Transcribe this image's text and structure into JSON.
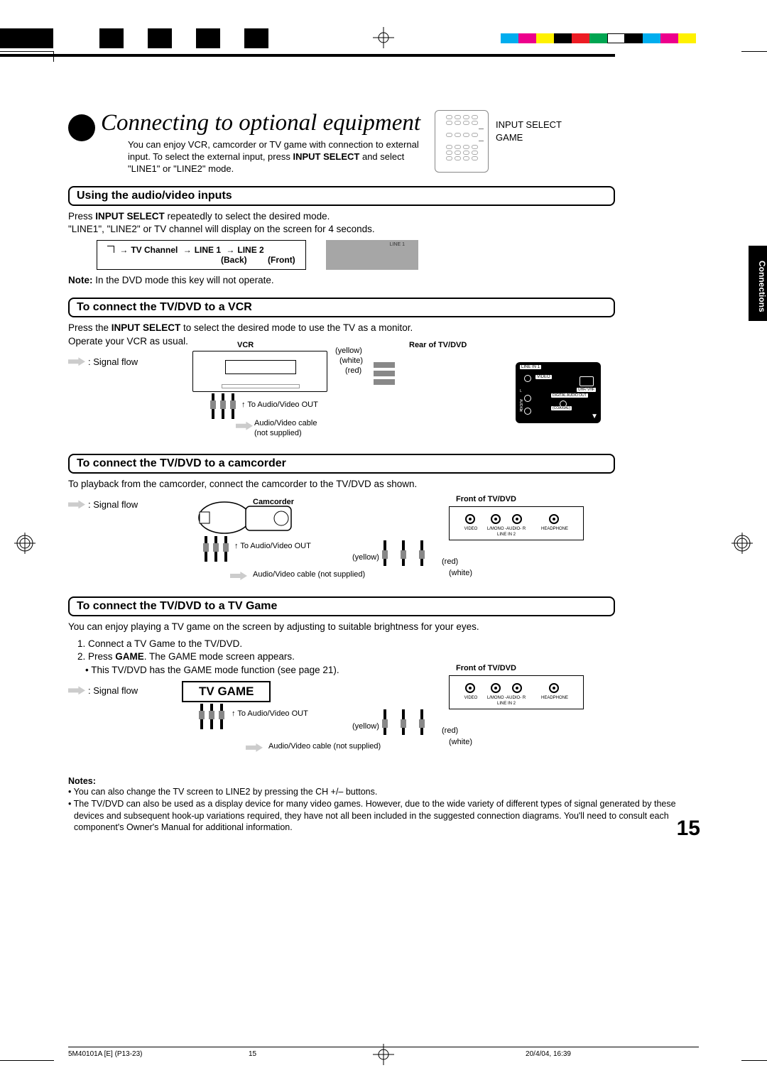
{
  "colorbar": {
    "colors": [
      "#00adee",
      "#ed008c",
      "#fff100",
      "#000",
      "#ec1c24",
      "#00a551",
      "#fff",
      "#000",
      "#00adee",
      "#ed008c",
      "#fff100"
    ]
  },
  "sidetab": "Connections",
  "title": "Connecting to optional equipment",
  "intro": "You can enjoy VCR, camcorder or TV game with connection to external input. To select the external input, press INPUT SELECT and select \"LINE1\" or \"LINE2\" mode.",
  "intro_bold": "INPUT SELECT",
  "remote_labels": {
    "l1": "INPUT SELECT",
    "l2": "GAME"
  },
  "s1": {
    "h": "Using the audio/video inputs",
    "p1a": "Press ",
    "p1b": "INPUT SELECT",
    "p1c": " repeatedly to select the desired mode.",
    "p2": "\"LINE1\", \"LINE2\" or TV channel will display on the screen for 4 seconds.",
    "flow": {
      "a": "TV Channel",
      "b": "LINE 1",
      "bsub": "(Back)",
      "c": "LINE 2",
      "csub": "(Front)"
    },
    "screen": "LINE 1",
    "note_b": "Note:",
    "note": " In the DVD mode this key will not operate."
  },
  "s2": {
    "h": "To connect the TV/DVD to a VCR",
    "p1a": "Press the ",
    "p1b": "INPUT SELECT",
    "p1c": " to select the desired mode to use the TV as a monitor.",
    "p2": "Operate your VCR as usual.",
    "sig": ": Signal flow",
    "vcr": "VCR",
    "rear": "Rear of TV/DVD",
    "yellow": "(yellow)",
    "white": "(white)",
    "red": "(red)",
    "toav": "To Audio/Video OUT",
    "cable": "Audio/Video cable",
    "ns": "(not supplied)",
    "linein": "LINE IN 1",
    "video": "VIDEO",
    "uhf": "UHF/ VHF",
    "dao": "DIGITAL AUDIO OUT",
    "coax": "(COAXIAL)",
    "audio": "AUDIO",
    "L": "L",
    "R": "R"
  },
  "s3": {
    "h": "To connect the TV/DVD to a camcorder",
    "p": "To playback from the camcorder, connect the camcorder to the TV/DVD as shown.",
    "sig": ": Signal flow",
    "cam": "Camcorder",
    "front": "Front of TV/DVD",
    "toav": "To Audio/Video OUT",
    "cable": "Audio/Video cable (not supplied)",
    "yellow": "(yellow)",
    "white": "(white)",
    "red": "(red)",
    "jv": "VIDEO",
    "jl": "L/MONO -AUDIO- R",
    "jh": "HEADPHONE",
    "lin": "LINE IN 2"
  },
  "s4": {
    "h": "To connect the TV/DVD to a TV Game",
    "p": "You can enjoy playing a TV game on the screen by adjusting to suitable brightness for your eyes.",
    "li1": "Connect a TV Game to the TV/DVD.",
    "li2a": "Press ",
    "li2b": "GAME",
    "li2c": ". The GAME mode screen appears.",
    "li2bul": "This TV/DVD has the GAME mode function (see page 21).",
    "sig": ": Signal flow",
    "tvgame": "TV GAME",
    "front": "Front of TV/DVD",
    "toav": "To Audio/Video OUT",
    "cable": "Audio/Video cable (not supplied)",
    "yellow": "(yellow)",
    "white": "(white)",
    "red": "(red)",
    "jv": "VIDEO",
    "jl": "L/MONO -AUDIO- R",
    "jh": "HEADPHONE",
    "lin": "LINE IN 2"
  },
  "notes": {
    "h": "Notes:",
    "n1": "You can also change the TV screen to LINE2 by pressing the CH +/– buttons.",
    "n2": "The TV/DVD can also be used as a display device for many video games. However, due to the wide variety of different types of signal generated by these devices and subsequent hook-up variations required, they have not all been included in the suggested connection diagrams. You'll need to consult each component's Owner's Manual for additional information."
  },
  "pagenum": "15",
  "footer": {
    "left": "5M40101A [E] (P13-23)",
    "mid": "15",
    "right": "20/4/04, 16:39"
  }
}
